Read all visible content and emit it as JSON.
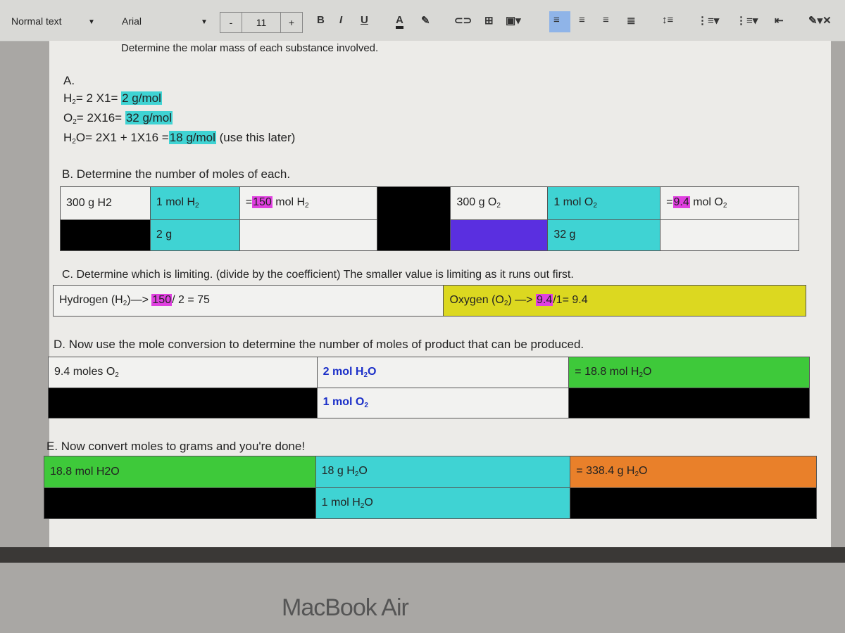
{
  "toolbar": {
    "style": "Normal text",
    "font": "Arial",
    "font_size": "11",
    "decrease": "-",
    "increase": "+",
    "bold": "B",
    "italic": "I",
    "underline": "U",
    "text_color": "A"
  },
  "doc": {
    "intro": "Determine the molar mass of each substance involved.",
    "section_a": {
      "label": "A.",
      "lines": [
        [
          {
            "t": "H"
          },
          {
            "t": "2",
            "sub": true
          },
          {
            "t": "= 2 X1= "
          },
          {
            "t": "2 g/mol",
            "hl": "#3fd3d3"
          }
        ],
        [
          {
            "t": "O"
          },
          {
            "t": "2",
            "sub": true
          },
          {
            "t": "= 2X16= "
          },
          {
            "t": "32 g/mol",
            "hl": "#3fd3d3"
          }
        ],
        [
          {
            "t": "H"
          },
          {
            "t": "2",
            "sub": true
          },
          {
            "t": "O= 2X1 + 1X16 ="
          },
          {
            "t": "18 g/mol",
            "hl": "#3fd3d3"
          },
          {
            "t": " (use this later)"
          }
        ]
      ]
    },
    "section_b": {
      "heading": "B. Determine the number of moles of each.",
      "rows": [
        [
          {
            "bg": "#f2f2f0",
            "seg": [
              {
                "t": "300 g H2"
              }
            ]
          },
          {
            "bg": "#3fd3d3",
            "seg": [
              {
                "t": "1 mol H"
              },
              {
                "t": "2",
                "sub": true
              }
            ]
          },
          {
            "bg": "#f2f2f0",
            "seg": [
              {
                "t": "="
              },
              {
                "t": "150",
                "hl": "#e040e0"
              },
              {
                "t": " mol H"
              },
              {
                "t": "2",
                "sub": true
              }
            ]
          },
          {
            "bg": "#000000",
            "rowspan": 2,
            "seg": []
          },
          {
            "bg": "#f2f2f0",
            "seg": [
              {
                "t": "300 g O"
              },
              {
                "t": "2",
                "sub": true
              }
            ]
          },
          {
            "bg": "#3fd3d3",
            "seg": [
              {
                "t": "1 mol O"
              },
              {
                "t": "2",
                "sub": true
              }
            ]
          },
          {
            "bg": "#f2f2f0",
            "seg": [
              {
                "t": "="
              },
              {
                "t": "9.4",
                "hl": "#e040e0"
              },
              {
                "t": " mol O"
              },
              {
                "t": "2",
                "sub": true
              }
            ]
          }
        ],
        [
          {
            "bg": "#000000",
            "seg": []
          },
          {
            "bg": "#3fd3d3",
            "seg": [
              {
                "t": "2 g"
              }
            ]
          },
          {
            "bg": "#f2f2f0",
            "seg": []
          },
          {
            "bg": "#5a2fe0",
            "seg": []
          },
          {
            "bg": "#3fd3d3",
            "seg": [
              {
                "t": "32 g"
              }
            ]
          },
          {
            "bg": "#f2f2f0",
            "seg": []
          }
        ]
      ]
    },
    "section_c": {
      "heading": "C.  Determine which is limiting.  (divide by the coefficient)  The smaller value is limiting as it runs out first.",
      "rows": [
        [
          {
            "bg": "#f2f2f0",
            "seg": [
              {
                "t": "Hydrogen (H"
              },
              {
                "t": "2",
                "sub": true
              },
              {
                "t": ")—> "
              },
              {
                "t": "150",
                "hl": "#e040e0"
              },
              {
                "t": "/ 2 = 75"
              }
            ]
          },
          {
            "bg": "#dcd820",
            "seg": [
              {
                "t": "Oxygen (O"
              },
              {
                "t": "2",
                "sub": true
              },
              {
                "t": ") —> "
              },
              {
                "t": "9.4",
                "hl": "#e040e0"
              },
              {
                "t": "/1= 9.4"
              }
            ]
          }
        ]
      ]
    },
    "section_d": {
      "heading": "D.  Now use the mole conversion to determine the number of moles of product that can be produced.",
      "rows": [
        [
          {
            "bg": "#f2f2f0",
            "seg": [
              {
                "t": "9.4 moles O"
              },
              {
                "t": "2",
                "sub": true
              }
            ]
          },
          {
            "bg": "#f2f2f0",
            "blue": true,
            "seg": [
              {
                "t": "2 mol H"
              },
              {
                "t": "2",
                "sub": true
              },
              {
                "t": "O"
              }
            ]
          },
          {
            "bg": "#3ec93a",
            "seg": [
              {
                "t": "= 18.8 mol H"
              },
              {
                "t": "2",
                "sub": true
              },
              {
                "t": "O"
              }
            ]
          }
        ],
        [
          {
            "bg": "#000000",
            "seg": []
          },
          {
            "bg": "#f2f2f0",
            "blue": true,
            "seg": [
              {
                "t": "1 mol O"
              },
              {
                "t": "2",
                "sub": true
              }
            ]
          },
          {
            "bg": "#000000",
            "seg": []
          }
        ]
      ]
    },
    "section_e": {
      "heading": "E.  Now convert moles to grams and you're done!",
      "rows": [
        [
          {
            "bg": "#3ec93a",
            "seg": [
              {
                "t": "18.8 mol H2O"
              }
            ]
          },
          {
            "bg": "#3fd3d3",
            "seg": [
              {
                "t": "18 g H"
              },
              {
                "t": "2",
                "sub": true
              },
              {
                "t": "O"
              }
            ]
          },
          {
            "bg": "#e9802a",
            "seg": [
              {
                "t": "= 338.4 g H"
              },
              {
                "t": "2",
                "sub": true
              },
              {
                "t": "O"
              }
            ]
          }
        ],
        [
          {
            "bg": "#000000",
            "seg": []
          },
          {
            "bg": "#3fd3d3",
            "seg": [
              {
                "t": "1 mol H"
              },
              {
                "t": "2",
                "sub": true
              },
              {
                "t": "O"
              }
            ]
          },
          {
            "bg": "#000000",
            "seg": []
          }
        ]
      ]
    }
  },
  "laptop": {
    "brand": "MacBook Air"
  }
}
